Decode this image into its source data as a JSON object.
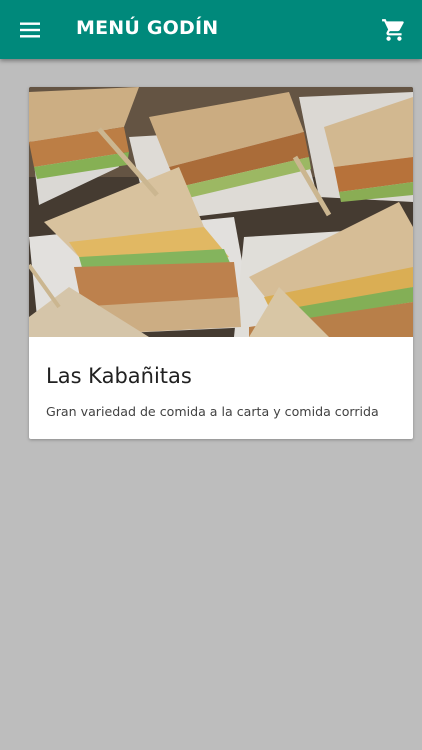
{
  "app_bar": {
    "title": "MENÚ GODÍN",
    "menu_icon": "hamburger-menu-icon",
    "cart_icon": "shopping-cart-icon",
    "color": "#00897b"
  },
  "restaurants": [
    {
      "name": "Las Kabañitas",
      "description": "Gran variedad de comida a la carta y comida corrida",
      "image": "club-sandwiches-photo"
    }
  ],
  "colors": {
    "background": "#bdbdbd",
    "card": "#ffffff",
    "title_text": "#ffffff"
  }
}
